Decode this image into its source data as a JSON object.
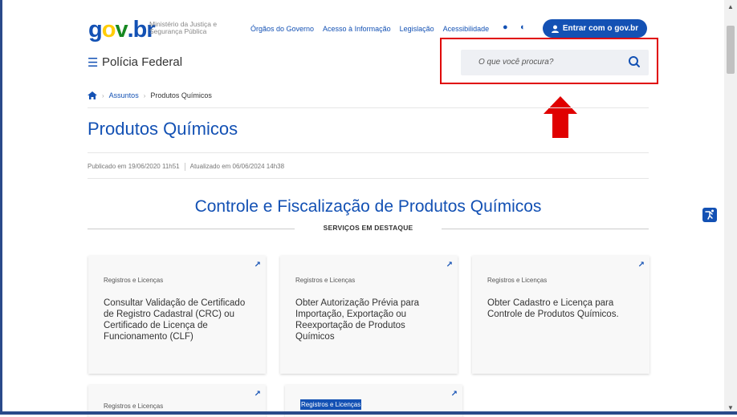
{
  "header": {
    "ministry_line1": "Ministério da Justiça e",
    "ministry_line2": "Segurança Pública",
    "links": [
      "Órgãos do Governo",
      "Acesso à Informação",
      "Legislação",
      "Acessibilidade"
    ],
    "login_label": "Entrar com o gov.br"
  },
  "site": {
    "name": "Polícia Federal",
    "search_placeholder": "O que você procura?"
  },
  "breadcrumb": {
    "items": [
      "Assuntos",
      "Produtos Químicos"
    ]
  },
  "page": {
    "title": "Produtos Químicos",
    "published": "Publicado em 19/06/2020 11h51",
    "updated": "Atualizado em 06/06/2024 14h38",
    "section_title": "Controle e Fiscalização de Produtos Químicos",
    "section_subtitle": "SERVIÇOS EM DESTAQUE"
  },
  "cards": [
    {
      "category": "Registros e Licenças",
      "text": "Consultar Validação de Certificado de Registro Cadastral (CRC) ou Certificado de Licença de Funcionamento (CLF)"
    },
    {
      "category": "Registros e Licenças",
      "text": "Obter Autorização Prévia para Importação, Exportação ou Reexportação de Produtos Químicos"
    },
    {
      "category": "Registros e Licenças",
      "text": "Obter Cadastro e Licença para Controle de Produtos Químicos."
    },
    {
      "category": "Registros e Licenças",
      "text": ""
    },
    {
      "category": "Registros e Licenças",
      "text": ""
    }
  ],
  "colors": {
    "brand_blue": "#1351b4",
    "highlight_red": "#e00000"
  },
  "icons": [
    "menu-icon",
    "search-icon",
    "home-icon",
    "user-icon",
    "contrast-icon",
    "external-link-icon",
    "accessibility-icon"
  ]
}
